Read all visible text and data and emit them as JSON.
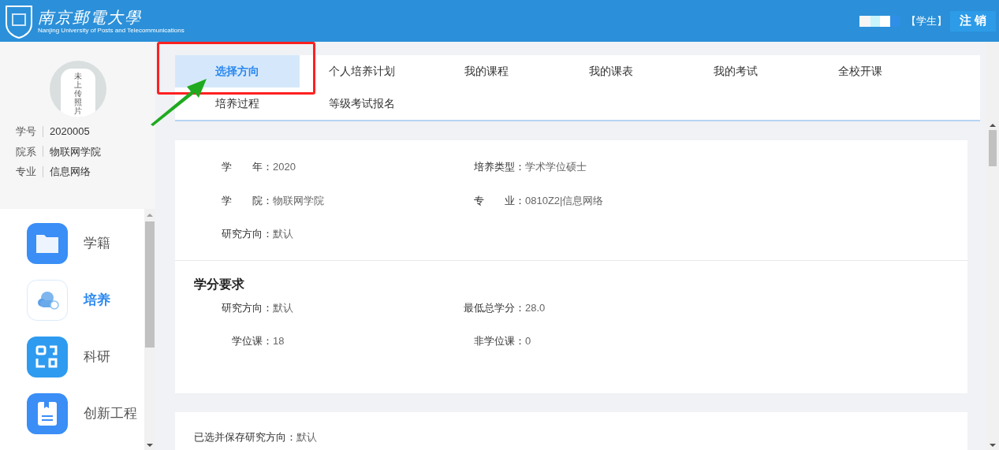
{
  "header": {
    "logo_cn": "南京郵電大學",
    "logo_en": "Nanjing University of Posts and Telecommunications",
    "role": "【学生】",
    "logout": "注 销"
  },
  "profile": {
    "avatar_text": "未上传照片",
    "fields": [
      {
        "label": "学号",
        "value": "2020005"
      },
      {
        "label": "院系",
        "value": "物联网学院"
      },
      {
        "label": "专业",
        "value": "信息网络"
      }
    ]
  },
  "nav": [
    {
      "label": "学籍",
      "kind": "folder",
      "selected": false
    },
    {
      "label": "培养",
      "kind": "cloud",
      "selected": true
    },
    {
      "label": "科研",
      "kind": "grid",
      "selected": false
    },
    {
      "label": "创新工程",
      "kind": "book",
      "selected": false
    }
  ],
  "tabs": [
    {
      "label": "选择方向",
      "selected": true
    },
    {
      "label": "个人培养计划",
      "selected": false
    },
    {
      "label": "我的课程",
      "selected": false
    },
    {
      "label": "我的课表",
      "selected": false
    },
    {
      "label": "我的考试",
      "selected": false
    },
    {
      "label": "全校开课",
      "selected": false
    },
    {
      "label": "培养过程",
      "selected": false
    },
    {
      "label": "等级考试报名",
      "selected": false
    }
  ],
  "info": {
    "fields": [
      {
        "label": "学　　年：",
        "value": "2020"
      },
      {
        "label": "培养类型：",
        "value": "学术学位硕士"
      },
      {
        "label": "学　　院：",
        "value": "物联网学院"
      },
      {
        "label": "专　　业：",
        "value": "0810Z2|信息网络"
      },
      {
        "label": "研究方向：",
        "value": "默认"
      }
    ]
  },
  "credits": {
    "title": "学分要求",
    "fields": [
      {
        "label": "研究方向：",
        "value": "默认"
      },
      {
        "label": "最低总学分：",
        "value": "28.0"
      },
      {
        "label": "学位课：",
        "value": "18"
      },
      {
        "label": "非学位课：",
        "value": "0"
      }
    ]
  },
  "saved": {
    "label": "已选并保存研究方向：",
    "value": "默认"
  }
}
